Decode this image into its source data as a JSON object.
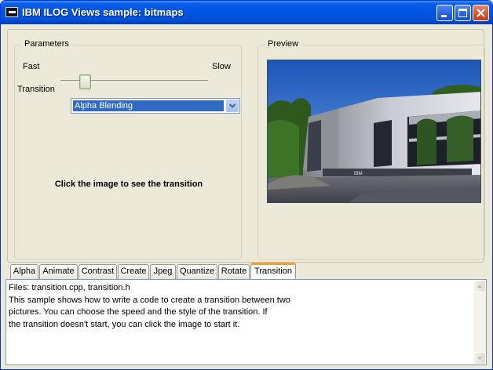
{
  "window": {
    "title": "IBM ILOG Views sample: bitmaps",
    "minimize_icon": "minimize-icon",
    "maximize_icon": "maximize-icon",
    "close_icon": "close-icon"
  },
  "parameters": {
    "group_label": "Parameters",
    "speed_min_label": "Fast",
    "speed_max_label": "Slow",
    "speed_value_fraction": 0.17,
    "transition_label": "Transition",
    "transition_value": "Alpha Blending",
    "hint": "Click the image to see the transition"
  },
  "preview": {
    "group_label": "Preview",
    "image_description_icon": "building-photo"
  },
  "tabs": [
    {
      "label": "Alpha"
    },
    {
      "label": "Animate"
    },
    {
      "label": "Contrast"
    },
    {
      "label": "Create"
    },
    {
      "label": "Jpeg"
    },
    {
      "label": "Quantize"
    },
    {
      "label": "Rotate"
    },
    {
      "label": "Transition",
      "active": true
    }
  ],
  "description": {
    "lines": [
      "Files: transition.cpp, transition.h",
      "This sample shows how to write a code to create a transition between two",
      "pictures. You can choose the speed and the style of the transition. If",
      "the transition doesn't start, you can click the image to start it."
    ]
  },
  "colors": {
    "titlebar": "#0054e3",
    "selection": "#316ac5",
    "active_tab_accent": "#f0a030"
  }
}
